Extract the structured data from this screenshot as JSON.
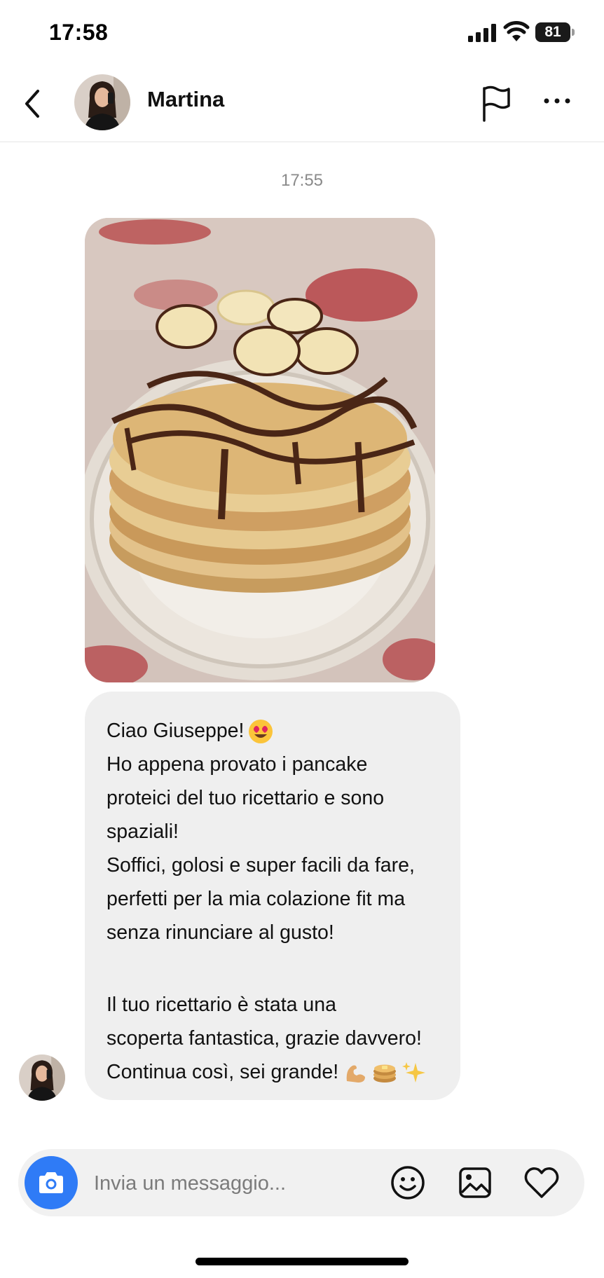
{
  "status_bar": {
    "time": "17:58",
    "battery_level": "81"
  },
  "header": {
    "contact_name": "Martina"
  },
  "conversation": {
    "timestamp": "17:55",
    "message_lines": [
      "Ciao Giuseppe!",
      "Ho appena provato i pancake",
      "proteici del tuo ricettario e sono",
      "spaziali!",
      "Soffici, golosi e super facili da fare,",
      "perfetti per la mia colazione fit ma",
      "senza rinunciare al gusto!",
      "",
      "Il tuo ricettario è stata una",
      "scoperta fantastica, grazie davvero!",
      "Continua così, sei grande!"
    ],
    "emojis": [
      "smiling-face-with-heart-eyes",
      "flexed-biceps",
      "pancakes",
      "sparkles"
    ]
  },
  "composer": {
    "placeholder": "Invia un messaggio..."
  },
  "icons": [
    "back-icon",
    "flag-icon",
    "more-icon",
    "camera-icon",
    "smiley-icon",
    "image-icon",
    "heart-icon"
  ],
  "colors": {
    "accent": "#2f7bf6",
    "bubble": "#efefef",
    "composer": "#f1f1f1",
    "timestamp": "#8a8a8a"
  }
}
